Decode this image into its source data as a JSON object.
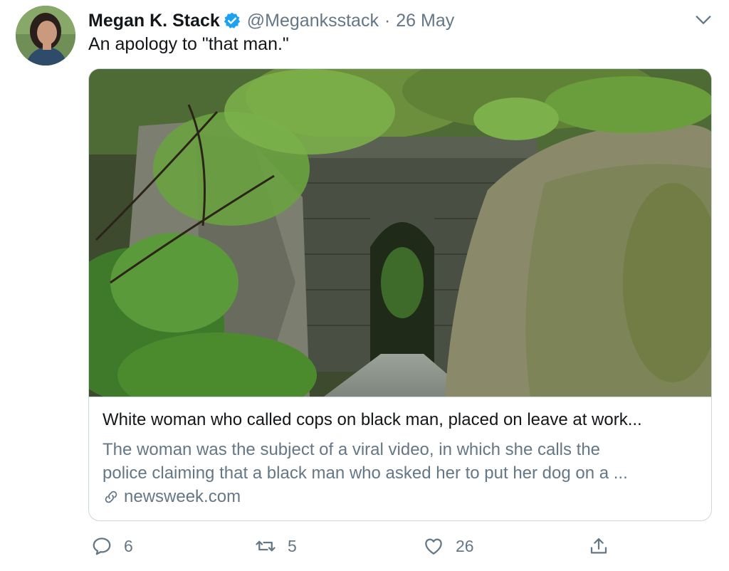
{
  "tweet": {
    "author_name": "Megan K. Stack",
    "handle": "@Meganksstack",
    "separator": "·",
    "date": "26 May",
    "text": "An apology to \"that man.\""
  },
  "card": {
    "title": "White woman who called cops on black man, placed on leave at work...",
    "description_lines": [
      "The woman was the subject of a viral video, in which she calls the",
      "police claiming that a black man who asked her to put her dog on a ..."
    ],
    "domain": "newsweek.com"
  },
  "actions": {
    "reply_count": "6",
    "retweet_count": "5",
    "like_count": "26"
  },
  "colors": {
    "text": "#14171a",
    "secondary": "#657786",
    "verified": "#1da1f2",
    "border": "#ccd6dd"
  },
  "icons": [
    "avatar",
    "verified-badge-icon",
    "chevron-down-icon",
    "link-icon",
    "reply-icon",
    "retweet-icon",
    "like-icon",
    "share-icon"
  ]
}
